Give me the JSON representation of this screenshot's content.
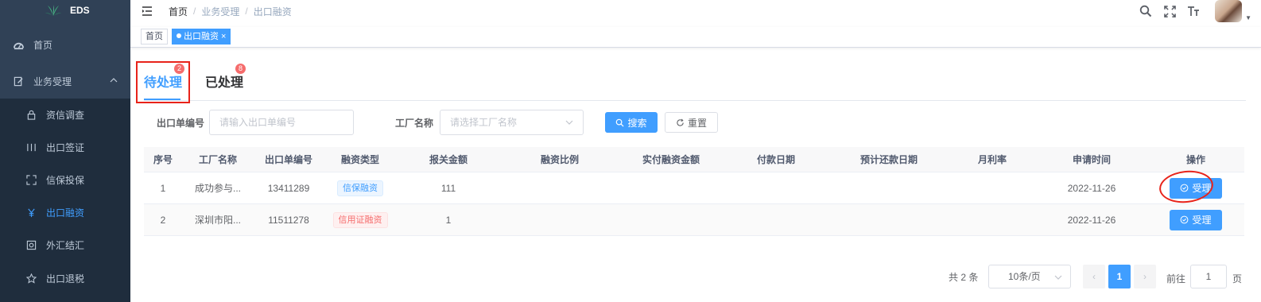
{
  "app": {
    "logo_text": "EDS"
  },
  "sidebar": {
    "items": [
      {
        "label": "首页",
        "icon": "dashboard-icon"
      },
      {
        "label": "业务受理",
        "icon": "edit-doc-icon",
        "expanded": true
      },
      {
        "label": "资信调查",
        "icon": "lock-icon"
      },
      {
        "label": "出口签证",
        "icon": "columns-icon"
      },
      {
        "label": "信保投保",
        "icon": "fullscreen-icon"
      },
      {
        "label": "出口融资",
        "icon": "money-icon",
        "active": true
      },
      {
        "label": "外汇结汇",
        "icon": "exchange-icon"
      },
      {
        "label": "出口退税",
        "icon": "star-icon"
      }
    ]
  },
  "header": {
    "breadcrumb": [
      "首页",
      "业务受理",
      "出口融资"
    ],
    "separator": "/",
    "icons": [
      "search-icon",
      "fullscreen-icon",
      "font-size-icon"
    ],
    "caret": "▼"
  },
  "tags": [
    {
      "label": "首页",
      "active": false
    },
    {
      "label": "出口融资",
      "active": true,
      "close": "×"
    }
  ],
  "tabs": [
    {
      "label": "待处理",
      "badge": "2",
      "active": true
    },
    {
      "label": "已处理",
      "badge": "8",
      "active": false
    }
  ],
  "search": {
    "export_no_label": "出口单编号",
    "export_no_placeholder": "请输入出口单编号",
    "factory_label": "工厂名称",
    "factory_placeholder": "请选择工厂名称",
    "search_button": "搜索",
    "reset_button": "重置"
  },
  "table": {
    "columns": [
      "序号",
      "工厂名称",
      "出口单编号",
      "融资类型",
      "报关金额",
      "融资比例",
      "实付融资金额",
      "付款日期",
      "预计还款日期",
      "月利率",
      "申请时间",
      "操作"
    ],
    "rows": [
      {
        "index": "1",
        "factory": "成功参与...",
        "export_no": "13411289",
        "finance_type": "信保融资",
        "type_style": "info",
        "amount": "111",
        "ratio": "",
        "paid": "",
        "pay_date": "",
        "repay_date": "",
        "rate": "",
        "apply_time": "2022-11-26",
        "action": "受理"
      },
      {
        "index": "2",
        "factory": "深圳市阳...",
        "export_no": "11511278",
        "finance_type": "信用证融资",
        "type_style": "danger",
        "amount": "1",
        "ratio": "",
        "paid": "",
        "pay_date": "",
        "repay_date": "",
        "rate": "",
        "apply_time": "2022-11-26",
        "action": "受理"
      }
    ]
  },
  "pagination": {
    "total": "共 2 条",
    "page_size": "10条/页",
    "prev": "‹",
    "current": "1",
    "next": "›",
    "goto_label": "前往",
    "goto_value": "1",
    "page_unit": "页"
  },
  "colors": {
    "primary": "#409eff",
    "sidebar_bg": "#304156",
    "submenu_bg": "#1f2d3d",
    "badge": "#f56c6c",
    "annotation_red": "#e8231a"
  }
}
